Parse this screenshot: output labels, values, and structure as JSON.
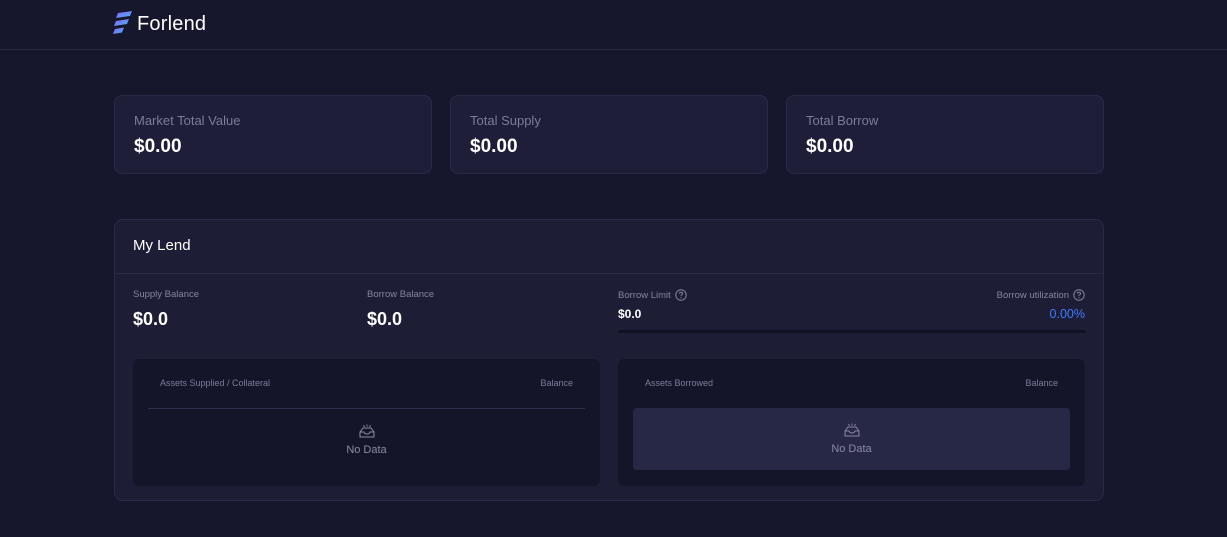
{
  "app": {
    "logo_text": "Forlend",
    "logo_gradient": [
      "#8a5cf6",
      "#3fa9f5"
    ]
  },
  "stats": [
    {
      "label": "Market Total Value",
      "value": "$0.00"
    },
    {
      "label": "Total Supply",
      "value": "$0.00"
    },
    {
      "label": "Total Borrow",
      "value": "$0.00"
    }
  ],
  "my_lend": {
    "title": "My Lend",
    "supply_balance": {
      "label": "Supply Balance",
      "value": "$0.0"
    },
    "borrow_balance": {
      "label": "Borrow Balance",
      "value": "$0.0"
    },
    "borrow_limit": {
      "label": "Borrow Limit",
      "value": "$0.0",
      "icon": "help-icon"
    },
    "borrow_utilization": {
      "label": "Borrow utilization",
      "value": "0.00%",
      "icon": "help-icon",
      "color": "#3d7bff",
      "fraction": 0
    },
    "supplied_table": {
      "col_asset": "Assets Supplied / Collateral",
      "col_balance": "Balance",
      "empty_text": "No Data",
      "empty_icon": "inbox-icon"
    },
    "borrowed_table": {
      "col_asset": "Assets Borrowed",
      "col_balance": "Balance",
      "empty_text": "No Data",
      "empty_icon": "inbox-icon"
    }
  }
}
